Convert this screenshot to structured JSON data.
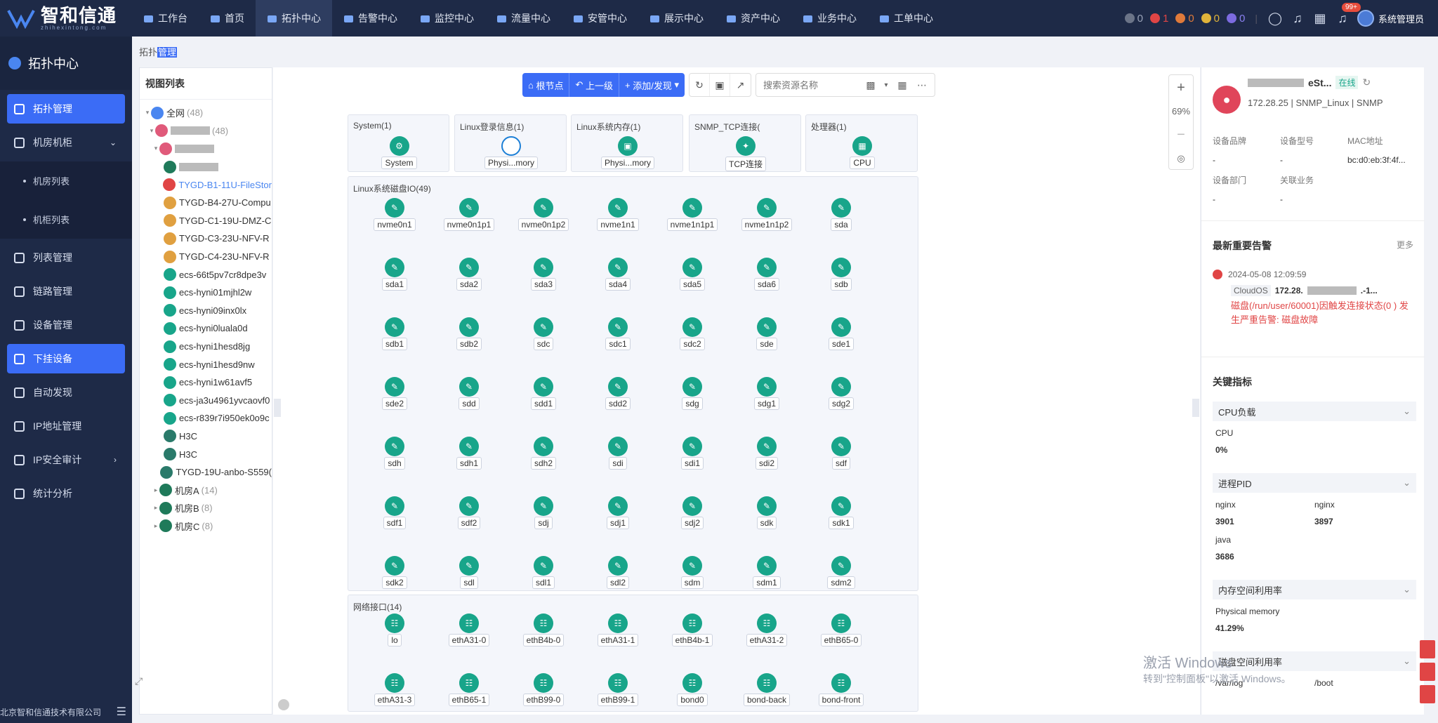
{
  "brand": {
    "title": "智和信通",
    "subtitle": "zhihexintong.com"
  },
  "topnav": [
    {
      "label": "工作台",
      "icon": "home-icon"
    },
    {
      "label": "首页",
      "icon": "home-icon"
    },
    {
      "label": "拓扑中心",
      "icon": "topology-icon",
      "active": true
    },
    {
      "label": "告警中心",
      "icon": "alarm-icon"
    },
    {
      "label": "监控中心",
      "icon": "monitor-icon"
    },
    {
      "label": "流量中心",
      "icon": "traffic-icon"
    },
    {
      "label": "安管中心",
      "icon": "shield-icon"
    },
    {
      "label": "展示中心",
      "icon": "display-icon"
    },
    {
      "label": "资产中心",
      "icon": "asset-icon"
    },
    {
      "label": "业务中心",
      "icon": "business-icon"
    },
    {
      "label": "工单中心",
      "icon": "ticket-icon"
    }
  ],
  "alarm_counts": [
    {
      "value": "0",
      "color": "#6b7488"
    },
    {
      "value": "1",
      "color": "#e04545"
    },
    {
      "value": "0",
      "color": "#e07a3a"
    },
    {
      "value": "0",
      "color": "#e0b43a"
    },
    {
      "value": "0",
      "color": "#7c6be0"
    }
  ],
  "alarm_count_colors": [
    "#9aa3b8",
    "#e04545",
    "#e07a3a",
    "#e0b43a",
    "#8a80f0"
  ],
  "notifications_badge": "99+",
  "user_name": "系统管理员",
  "sidebar": {
    "title": "拓扑中心",
    "items": [
      {
        "label": "拓扑管理",
        "active": true
      },
      {
        "label": "机房机柜",
        "expanded": true
      },
      {
        "label": "机房列表",
        "sub": true
      },
      {
        "label": "机柜列表",
        "sub": true
      },
      {
        "label": "列表管理"
      },
      {
        "label": "链路管理"
      },
      {
        "label": "设备管理"
      },
      {
        "label": "下挂设备",
        "active": true
      },
      {
        "label": "自动发现"
      },
      {
        "label": "IP地址管理"
      },
      {
        "label": "IP安全审计",
        "arrow": true
      },
      {
        "label": "统计分析"
      }
    ],
    "footer": "北京智和信通技术有限公司"
  },
  "breadcrumb": {
    "prefix": "拓扑",
    "selected": "管理"
  },
  "viewlist": {
    "title": "视图列表",
    "nodes": [
      {
        "label": "全网",
        "count": "(48)",
        "level": 0,
        "toggle": "▾",
        "color": "#4a86f0"
      },
      {
        "label": "",
        "count": "(48)",
        "level": 1,
        "toggle": "▾",
        "color": "#e05a7a",
        "masked": true
      },
      {
        "label": "",
        "count": "",
        "level": 2,
        "toggle": "▾",
        "color": "#e05a7a",
        "masked": true
      },
      {
        "label": "",
        "count": "",
        "level": 3,
        "toggle": "",
        "color": "#1f7a5a",
        "masked": true
      },
      {
        "label": "TYGD-B1-11U-FileStor",
        "count": "",
        "level": 3,
        "toggle": "",
        "color": "#e04545",
        "highlight": true
      },
      {
        "label": "TYGD-B4-27U-Compu",
        "count": "",
        "level": 3,
        "toggle": "",
        "color": "#e0a040"
      },
      {
        "label": "TYGD-C1-19U-DMZ-C",
        "count": "",
        "level": 3,
        "toggle": "",
        "color": "#e0a040"
      },
      {
        "label": "TYGD-C3-23U-NFV-R",
        "count": "",
        "level": 3,
        "toggle": "",
        "color": "#e0a040"
      },
      {
        "label": "TYGD-C4-23U-NFV-R",
        "count": "",
        "level": 3,
        "toggle": "",
        "color": "#e0a040"
      },
      {
        "label": "ecs-66t5pv7cr8dpe3v",
        "count": "",
        "level": 3,
        "toggle": "",
        "color": "#18a58a"
      },
      {
        "label": "ecs-hyni01mjhl2w",
        "count": "",
        "level": 3,
        "toggle": "",
        "color": "#18a58a"
      },
      {
        "label": "ecs-hyni09inx0lx",
        "count": "",
        "level": 3,
        "toggle": "",
        "color": "#18a58a"
      },
      {
        "label": "ecs-hyni0luala0d",
        "count": "",
        "level": 3,
        "toggle": "",
        "color": "#18a58a"
      },
      {
        "label": "ecs-hyni1hesd8jg",
        "count": "",
        "level": 3,
        "toggle": "",
        "color": "#18a58a"
      },
      {
        "label": "ecs-hyni1hesd9nw",
        "count": "",
        "level": 3,
        "toggle": "",
        "color": "#18a58a"
      },
      {
        "label": "ecs-hyni1w61avf5",
        "count": "",
        "level": 3,
        "toggle": "",
        "color": "#18a58a"
      },
      {
        "label": "ecs-ja3u4961yvcaovf0",
        "count": "",
        "level": 3,
        "toggle": "",
        "color": "#18a58a"
      },
      {
        "label": "ecs-r839r7i950ek0o9c",
        "count": "",
        "level": 3,
        "toggle": "",
        "color": "#18a58a"
      },
      {
        "label": "H3C",
        "count": "",
        "level": 3,
        "toggle": "",
        "color": "#2a7a6a"
      },
      {
        "label": "H3C",
        "count": "",
        "level": 3,
        "toggle": "",
        "color": "#2a7a6a"
      },
      {
        "label": "TYGD-19U-anbo-S559(",
        "count": "",
        "level": 3,
        "toggle": "",
        "color": "#2a7a6a"
      },
      {
        "label": "机房A",
        "count": "(14)",
        "level": 2,
        "toggle": "▸",
        "color": "#1f7a5a"
      },
      {
        "label": "机房B",
        "count": "(8)",
        "level": 2,
        "toggle": "▸",
        "color": "#1f7a5a"
      },
      {
        "label": "机房C",
        "count": "(8)",
        "level": 2,
        "toggle": "▸",
        "color": "#1f7a5a"
      }
    ]
  },
  "toolbar": {
    "root": "根节点",
    "up": "上一级",
    "add": "添加/发现",
    "search_placeholder": "搜索资源名称"
  },
  "zoom": {
    "level": "69%",
    "plus": "+",
    "minus": "−"
  },
  "groups": [
    {
      "title": "System(1)",
      "nodes": [
        "System"
      ]
    },
    {
      "title": "Linux登录信息(1)",
      "nodes": [
        "Physi...mory"
      ]
    },
    {
      "title": "Linux系统内存(1)",
      "nodes": [
        "Physi...mory"
      ]
    },
    {
      "title": "SNMP_TCP连接(",
      "nodes": [
        "TCP连接"
      ]
    },
    {
      "title": "处理器(1)",
      "nodes": [
        "CPU"
      ]
    }
  ],
  "disk_group": {
    "title": "Linux系统磁盘IO(49)",
    "nodes": [
      "nvme0n1",
      "nvme0n1p1",
      "nvme0n1p2",
      "nvme1n1",
      "nvme1n1p1",
      "nvme1n1p2",
      "sda",
      "sda1",
      "sda2",
      "sda3",
      "sda4",
      "sda5",
      "sda6",
      "sdb",
      "sdb1",
      "sdb2",
      "sdc",
      "sdc1",
      "sdc2",
      "sde",
      "sde1",
      "sde2",
      "sdd",
      "sdd1",
      "sdd2",
      "sdg",
      "sdg1",
      "sdg2",
      "sdh",
      "sdh1",
      "sdh2",
      "sdi",
      "sdi1",
      "sdi2",
      "sdf",
      "sdf1",
      "sdf2",
      "sdj",
      "sdj1",
      "sdj2",
      "sdk",
      "sdk1",
      "sdk2",
      "sdl",
      "sdl1",
      "sdl2",
      "sdm",
      "sdm1",
      "sdm2"
    ]
  },
  "net_group": {
    "title": "网络接口(14)",
    "nodes": [
      "lo",
      "ethA31-0",
      "ethB4b-0",
      "ethA31-1",
      "ethB4b-1",
      "ethA31-2",
      "ethB65-0",
      "ethA31-3",
      "ethB65-1",
      "ethB99-0",
      "ethB99-1",
      "bond0",
      "bond-back",
      "bond-front"
    ]
  },
  "panel": {
    "name_suffix": "eSt...",
    "status": "在线",
    "ip": "172.28.25",
    "meta": "| SNMP_Linux | SNMP",
    "fields": [
      {
        "label": "设备品牌",
        "value": "-"
      },
      {
        "label": "设备型号",
        "value": "-"
      },
      {
        "label": "MAC地址",
        "value": "bc:d0:eb:3f:4f..."
      },
      {
        "label": "设备部门",
        "value": "-"
      },
      {
        "label": "关联业务",
        "value": "-"
      }
    ],
    "alarm_title": "最新重要告警",
    "more": "更多",
    "alarm": {
      "time": "2024-05-08 12:09:59",
      "tag": "CloudOS",
      "ip": "172.28.",
      "suffix": ".-1...",
      "message": "磁盘(/run/user/60001)因触发连接状态(0 ) 发生严重告警: 磁盘故障"
    },
    "kpi_title": "关键指标",
    "kpis": [
      {
        "title": "CPU负载",
        "items": [
          {
            "label": "CPU",
            "value": "0%"
          }
        ]
      },
      {
        "title": "进程PID",
        "items": [
          {
            "label": "nginx",
            "value": "3901"
          },
          {
            "label": "nginx",
            "value": "3897"
          },
          {
            "label": "java",
            "value": "3686"
          }
        ]
      },
      {
        "title": "内存空间利用率",
        "items": [
          {
            "label": "Physical memory",
            "value": "41.29%"
          }
        ]
      },
      {
        "title": "磁盘空间利用率",
        "items": [
          {
            "label": "/var/log",
            "value": ""
          },
          {
            "label": "/boot",
            "value": ""
          }
        ]
      }
    ]
  },
  "watermark": {
    "line1": "激活 Windows",
    "line2": "转到\"控制面板\"以激活 Windows。"
  }
}
